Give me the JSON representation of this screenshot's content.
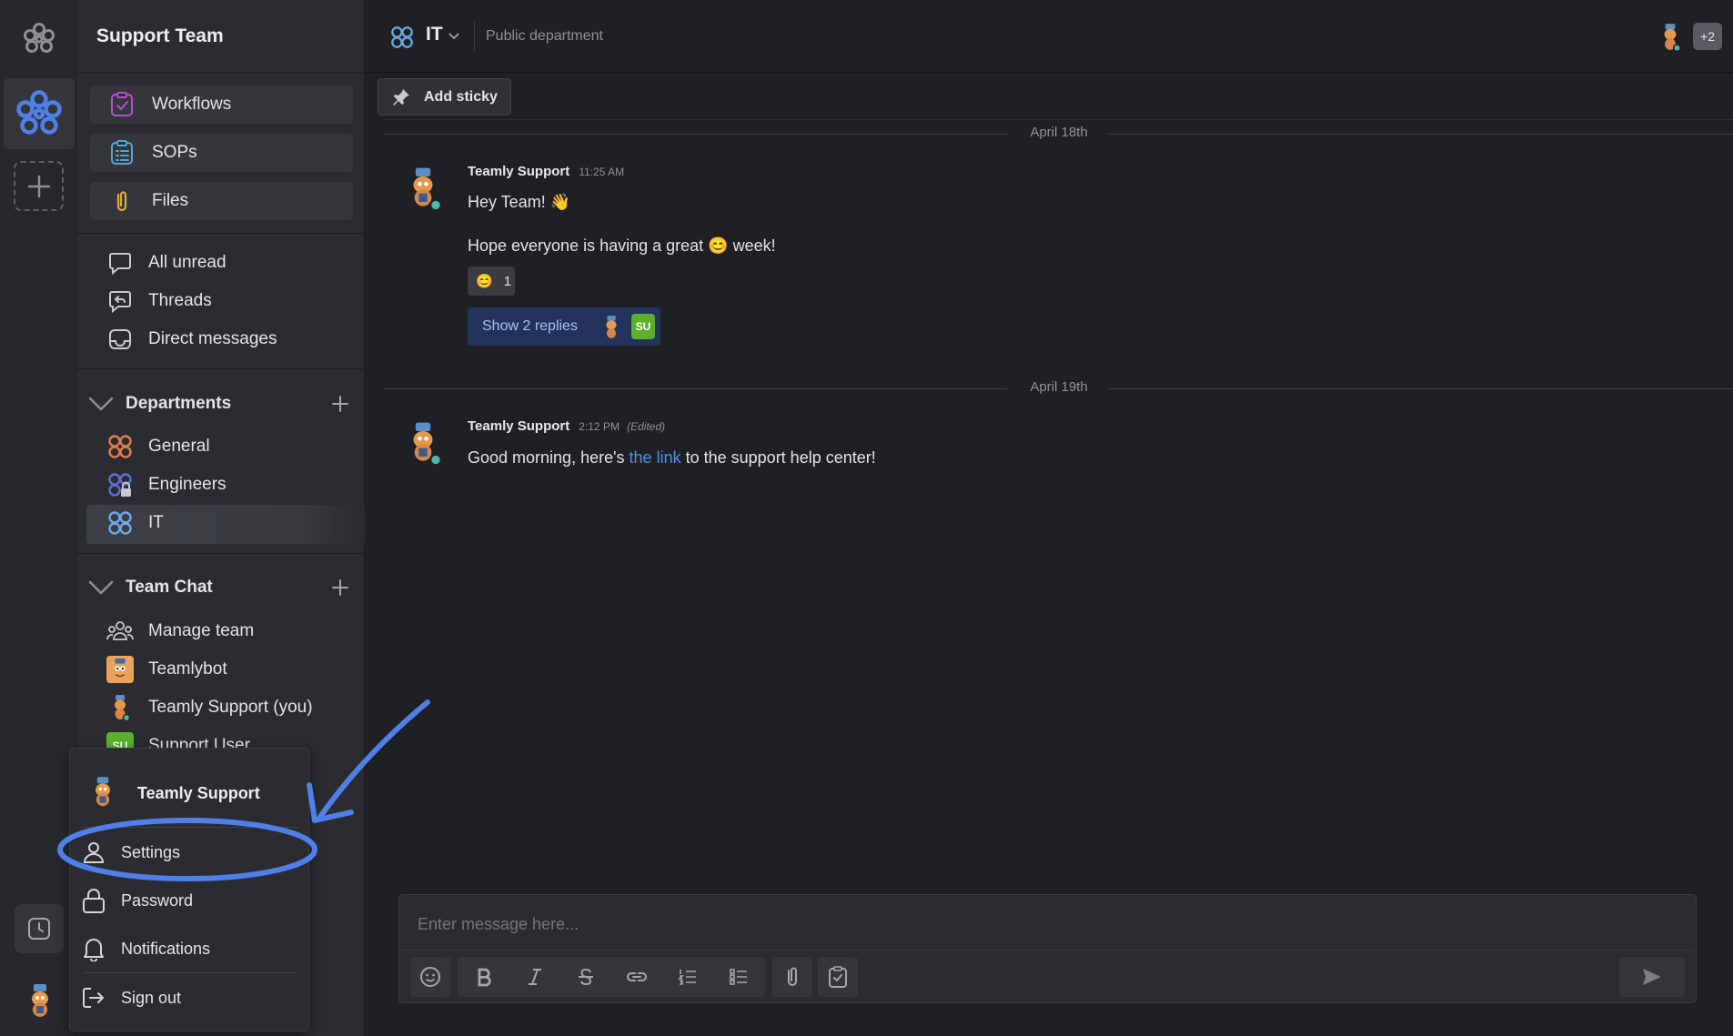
{
  "workspace": {
    "team_name": "Support Team"
  },
  "sidebar": {
    "top_items": [
      {
        "label": "Workflows",
        "icon": "workflows-icon"
      },
      {
        "label": "SOPs",
        "icon": "sops-icon"
      },
      {
        "label": "Files",
        "icon": "paperclip-icon"
      }
    ],
    "nav_items": [
      {
        "label": "All unread",
        "icon": "chat-bubble-icon"
      },
      {
        "label": "Threads",
        "icon": "threads-icon"
      },
      {
        "label": "Direct messages",
        "icon": "inbox-icon"
      }
    ],
    "departments": {
      "title": "Departments",
      "items": [
        {
          "label": "General",
          "color": "#e07c4f"
        },
        {
          "label": "Engineers",
          "color": "#5a6ed8"
        },
        {
          "label": "IT",
          "color": "#6fa8e8",
          "active": true
        }
      ]
    },
    "team_chat": {
      "title": "Team Chat",
      "items": [
        {
          "label": "Manage team"
        },
        {
          "label": "Teamlybot"
        },
        {
          "label": "Teamly Support (you)"
        },
        {
          "label": "Support User",
          "initials": "SU"
        }
      ]
    }
  },
  "channel": {
    "name": "IT",
    "description": "Public department",
    "member_overflow": "+2"
  },
  "toolbar": {
    "add_sticky_label": "Add sticky"
  },
  "messages": [
    {
      "date": "April 18th",
      "author": "Teamly Support",
      "time": "11:25 AM",
      "edited": "",
      "lines": [
        "Hey Team! 👋",
        "Hope everyone is having a great",
        "week!"
      ],
      "reaction_count": "1",
      "replies_label": "Show 2 replies",
      "reply_initials": "SU"
    },
    {
      "date": "April 19th",
      "author": "Teamly Support",
      "time": "2:12 PM",
      "edited": "(Edited)",
      "text_before": "Good morning, here's",
      "link_text": "the link",
      "text_after": "to the support help center!"
    }
  ],
  "composer": {
    "placeholder": "Enter message here..."
  },
  "user_menu": {
    "user_name": "Teamly Support",
    "items": [
      "Settings",
      "Password",
      "Notifications",
      "Sign out"
    ]
  },
  "colors": {
    "accent": "#4f7fe8",
    "online": "#4bb8a9",
    "su_badge": "#5ab02d"
  }
}
